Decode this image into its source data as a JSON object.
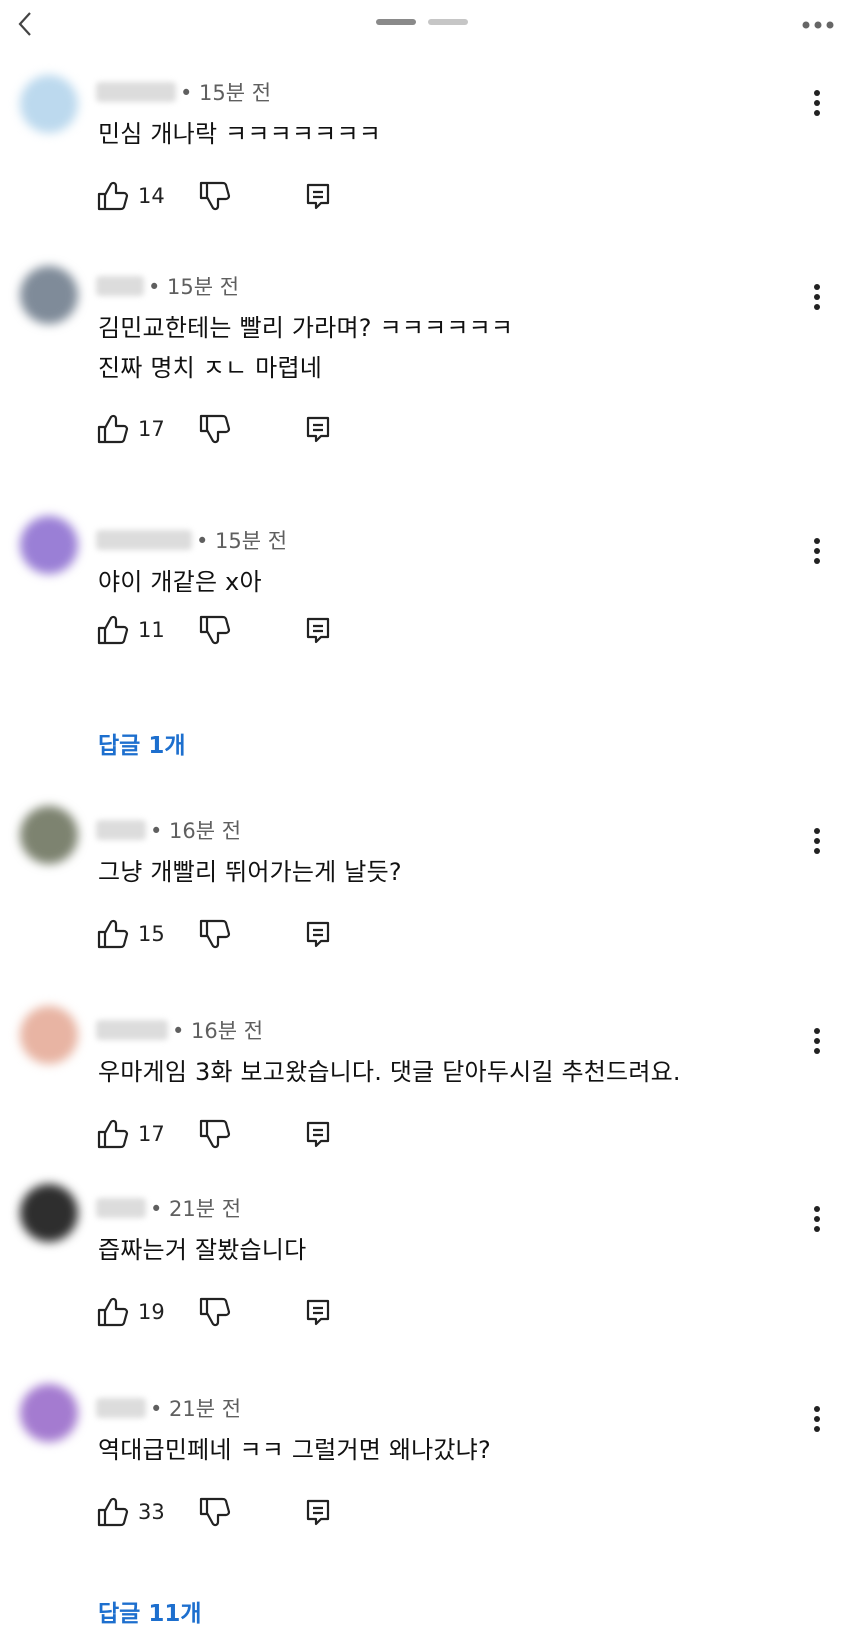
{
  "colors": {
    "link": "#1d6fce",
    "meta": "#5f5f5f",
    "text": "#111111"
  },
  "icons": {
    "back": "chevron-left-icon",
    "more": "more-horizontal-icon",
    "kebab": "more-vertical-icon",
    "like": "thumbs-up-icon",
    "dislike": "thumbs-down-icon",
    "reply": "reply-icon"
  },
  "comments": [
    {
      "time": "• 15분 전",
      "text": "민심 개나락 ㅋㅋㅋㅋㅋㅋㅋ",
      "likes": "14"
    },
    {
      "time": "• 15분 전",
      "text": "김민교한테는 빨리 가라며? ㅋㅋㅋㅋㅋㅋ\n진짜 명치 ㅈㄴ 마렵네",
      "likes": "17"
    },
    {
      "time": "• 15분 전",
      "text": "야이 개같은 x아",
      "likes": "11",
      "replies": "답글 1개"
    },
    {
      "time": "• 16분 전",
      "text": "그냥 개빨리 뛰어가는게 날듯?",
      "likes": "15"
    },
    {
      "time": "• 16분 전",
      "text": "우마게임 3화 보고왔습니다. 댓글 닫아두시길 추천드려요.",
      "likes": "17"
    },
    {
      "time": "• 21분 전",
      "text": "즙짜는거 잘봤습니다",
      "likes": "19"
    },
    {
      "time": "• 21분 전",
      "text": "역대급민페네 ㅋㅋ 그럴거면 왜나갔냐?",
      "likes": "33",
      "replies": "답글 11개"
    }
  ]
}
